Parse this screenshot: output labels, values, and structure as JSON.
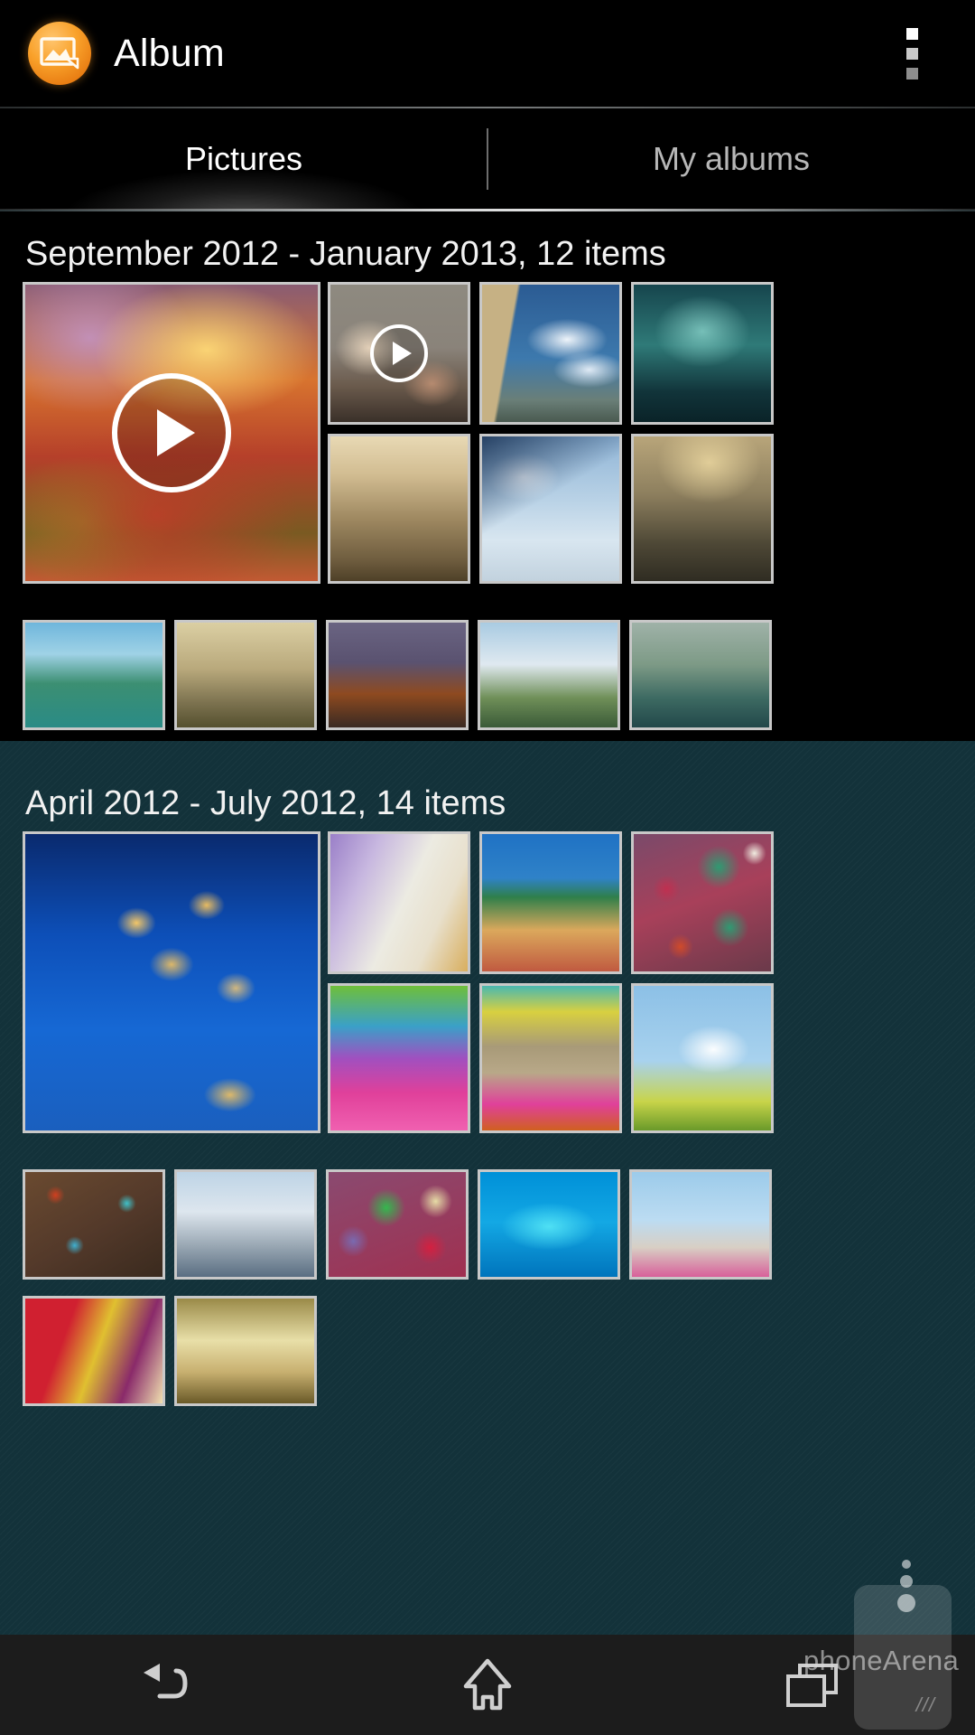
{
  "app": {
    "title": "Album",
    "icon": "photo-album-icon"
  },
  "actionbar": {
    "overflow_label": "More options",
    "overflow_icon": "overflow-menu-icon"
  },
  "tabs": [
    {
      "label": "Pictures",
      "active": true
    },
    {
      "label": "My albums",
      "active": false
    }
  ],
  "sections": [
    {
      "title": "September 2012 - January 2013, 12 items",
      "range_start": "September 2012",
      "range_end": "January 2013",
      "item_count": "12 items",
      "tiles": [
        {
          "name": "sunset-mountains-video",
          "type": "video",
          "size": "large",
          "colors": [
            "#6b4a63",
            "#ff8a3d",
            "#c8452c",
            "#8f6a1e"
          ]
        },
        {
          "name": "man-on-sofa-video",
          "type": "video",
          "size": "small",
          "colors": [
            "#8f8a80",
            "#c9b9a8",
            "#6b5b4c",
            "#3a3029"
          ]
        },
        {
          "name": "cliff-and-clouds-photo",
          "type": "photo",
          "size": "small",
          "colors": [
            "#2b4f7d",
            "#c6b184",
            "#9fc0e0",
            "#1d2f4d"
          ]
        },
        {
          "name": "misty-forest-photo",
          "type": "photo",
          "size": "small",
          "colors": [
            "#1c4a4f",
            "#7fd0c8",
            "#0d2b31",
            "#2b6f6a"
          ]
        },
        {
          "name": "sepia-cityscape-photo",
          "type": "photo",
          "size": "small",
          "colors": [
            "#d9c49a",
            "#8a7350",
            "#5a4630",
            "#efe0c0"
          ]
        },
        {
          "name": "glacier-mountain-photo",
          "type": "photo",
          "size": "small",
          "colors": [
            "#b9d2e6",
            "#3a5f86",
            "#e8f1f7",
            "#16304f"
          ]
        },
        {
          "name": "rainbow-valley-photo",
          "type": "photo",
          "size": "small",
          "colors": [
            "#8f7f5e",
            "#d8c49a",
            "#46402f",
            "#bba27a"
          ]
        },
        {
          "name": "halong-bay-photo",
          "type": "photo",
          "size": "small",
          "colors": [
            "#4aa3c2",
            "#2e7f5a",
            "#9fd8e6",
            "#1b5e4a"
          ]
        },
        {
          "name": "hazy-canyon-photo",
          "type": "photo",
          "size": "small",
          "colors": [
            "#a79566",
            "#dccf9e",
            "#5e5436",
            "#8a7a4e"
          ]
        },
        {
          "name": "red-rock-canyon-photo",
          "type": "photo",
          "size": "small",
          "colors": [
            "#5b5570",
            "#c06a2a",
            "#2b2536",
            "#8e4a1c"
          ]
        },
        {
          "name": "alpine-meadow-photo",
          "type": "photo",
          "size": "small",
          "colors": [
            "#9fc4de",
            "#5a7f4a",
            "#e7eef3",
            "#2f4f36"
          ]
        },
        {
          "name": "coastal-cliff-photo",
          "type": "photo",
          "size": "small",
          "colors": [
            "#6a8a6a",
            "#2c5a6a",
            "#cfd8c8",
            "#1d3a3a"
          ]
        }
      ]
    },
    {
      "title": "April 2012 - July 2012, 14 items",
      "range_start": "April 2012",
      "range_end": "July 2012",
      "item_count": "14 items",
      "tiles": [
        {
          "name": "snowy-village-night-photo",
          "type": "photo",
          "size": "large",
          "colors": [
            "#0d4fb8",
            "#f0b84a",
            "#0a2f6e",
            "#1a6ad0"
          ]
        },
        {
          "name": "santorini-houses-photo",
          "type": "photo",
          "size": "small",
          "colors": [
            "#e8e2d4",
            "#8a6fc0",
            "#d8b060",
            "#6a4fa0"
          ]
        },
        {
          "name": "cinque-terre-photo",
          "type": "photo",
          "size": "small",
          "colors": [
            "#1f6fc0",
            "#e0a85c",
            "#c05a40",
            "#2f7f4a"
          ]
        },
        {
          "name": "bokeh-baubles-photo",
          "type": "photo",
          "size": "small",
          "colors": [
            "#2f8f6a",
            "#c0305a",
            "#8fbf4a",
            "#d04a2a"
          ]
        },
        {
          "name": "colored-boats-photo",
          "type": "photo",
          "size": "small",
          "colors": [
            "#e0409a",
            "#6fbf3a",
            "#40a0d0",
            "#b03090"
          ]
        },
        {
          "name": "yarn-bundles-photo",
          "type": "photo",
          "size": "small",
          "colors": [
            "#c0b49a",
            "#e0409a",
            "#40b0c0",
            "#d06020"
          ]
        },
        {
          "name": "cloud-over-field-photo",
          "type": "photo",
          "size": "small",
          "colors": [
            "#8fc0e0",
            "#f0f4f8",
            "#c8d84a",
            "#5a8f2a"
          ]
        },
        {
          "name": "modern-apartments-photo",
          "type": "photo",
          "size": "small",
          "colors": [
            "#6a4a30",
            "#40b0c0",
            "#c03020",
            "#2a2018"
          ]
        },
        {
          "name": "snow-peak-photo",
          "type": "photo",
          "size": "small",
          "colors": [
            "#cfd8e6",
            "#6a90b8",
            "#8a9aa8",
            "#3a5a7a"
          ]
        },
        {
          "name": "fabric-roses-photo",
          "type": "photo",
          "size": "small",
          "colors": [
            "#30b050",
            "#d02040",
            "#e0d8a0",
            "#7a4aa0"
          ]
        },
        {
          "name": "turquoise-reef-photo",
          "type": "photo",
          "size": "small",
          "colors": [
            "#00a0e0",
            "#40d8f0",
            "#0060a0",
            "#80e8f8"
          ]
        },
        {
          "name": "beach-huts-photo",
          "type": "photo",
          "size": "small",
          "colors": [
            "#8fc8e8",
            "#e060a0",
            "#2a4a6a",
            "#d8d0c0"
          ]
        },
        {
          "name": "red-yellow-textile-photo",
          "type": "photo",
          "size": "small",
          "colors": [
            "#d02030",
            "#e0c030",
            "#8a2a6a",
            "#f0e0b0"
          ]
        },
        {
          "name": "autumn-trees-photo",
          "type": "photo",
          "size": "small",
          "colors": [
            "#c8b070",
            "#8a7a40",
            "#f0e8c8",
            "#5a4a20"
          ]
        }
      ]
    }
  ],
  "navbar": {
    "buttons": [
      {
        "label": "Back",
        "icon": "back-arrow-icon"
      },
      {
        "label": "Home",
        "icon": "home-icon"
      },
      {
        "label": "Recents",
        "icon": "recent-apps-icon"
      }
    ]
  },
  "watermark": {
    "text_light": "phone",
    "text_bold": "Arena",
    "full": "phoneArena"
  },
  "colors": {
    "accent": "#f9a12a",
    "background": "#13323a",
    "actionbar": "#000000",
    "navbar": "#1c1c1c",
    "tile_border": "#c8c8c8",
    "text_primary": "#ffffff",
    "text_inactive": "#b7b7b7"
  }
}
